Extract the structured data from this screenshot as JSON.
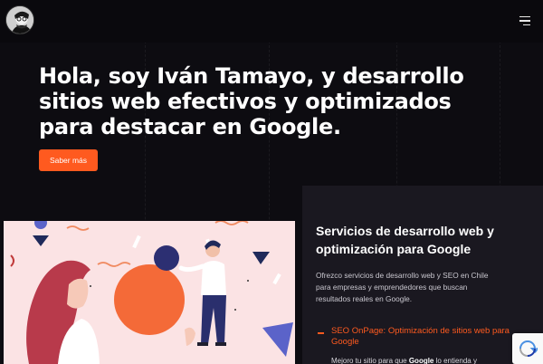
{
  "header": {
    "avatar_alt": "Iván Tamayo",
    "menu_icon": "hamburger-menu-icon"
  },
  "hero": {
    "title": "Hola, soy Iván Tamayo, y desarrollo sitios web efectivos y optimizados para destacar en Google.",
    "cta_label": "Saber más"
  },
  "services": {
    "title": "Servicios de desarrollo web y optimización para Google",
    "description": "Ofrezco servicios de desarrollo web y SEO en Chile para empresas y emprendedores que buscan resultados reales en Google.",
    "items": [
      {
        "label": "SEO OnPage: Optimización de sitios web para Google",
        "sub_prefix": "Mejoro tu sitio para que ",
        "sub_bold": "Google",
        "sub_suffix": " lo entienda y"
      }
    ]
  },
  "colors": {
    "accent": "#ff5a1f",
    "background": "#0d0c11",
    "panel": "#1a1820",
    "illustration_bg": "#fbe3e4"
  },
  "icons": {
    "recaptcha": "recaptcha-icon"
  }
}
